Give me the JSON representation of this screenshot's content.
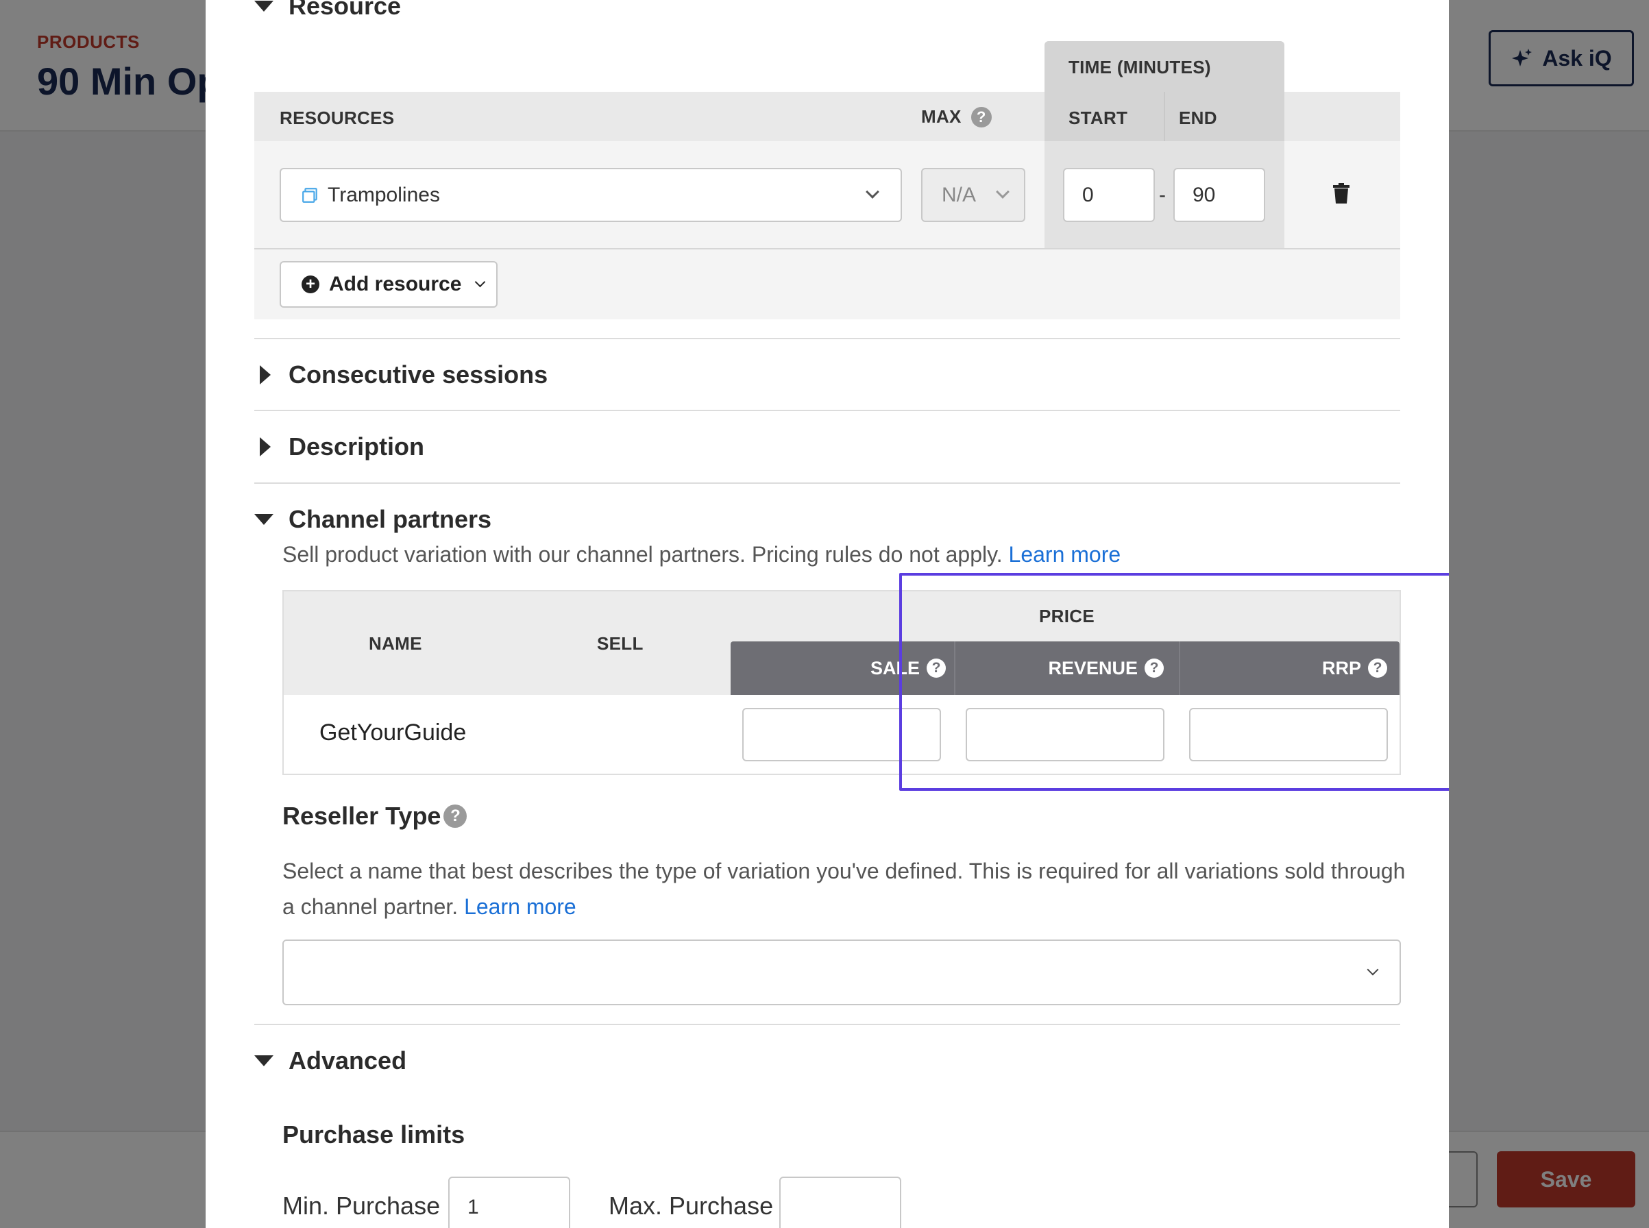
{
  "background": {
    "breadcrumb": "PRODUCTS",
    "page_title": "90 Min Op",
    "ask_iq_label": "Ask iQ",
    "save_label": "Save"
  },
  "resource": {
    "section_title": "Resource",
    "headers": {
      "resources": "RESOURCES",
      "max": "MAX",
      "time": "TIME (MINUTES)",
      "start": "START",
      "end": "END"
    },
    "row": {
      "resource_name": "Trampolines",
      "max_value": "N/A",
      "start_value": "0",
      "separator": "-",
      "end_value": "90"
    },
    "add_button": "Add resource"
  },
  "sections": {
    "consecutive": "Consecutive sessions",
    "description": "Description",
    "channel_partners": "Channel partners",
    "advanced": "Advanced"
  },
  "channel_partners": {
    "description": "Sell product variation with our channel partners. Pricing rules do not apply.",
    "learn_more": "Learn more",
    "headers": {
      "name": "NAME",
      "sell": "SELL",
      "price": "PRICE",
      "sale": "SALE",
      "revenue": "REVENUE",
      "rrp": "RRP"
    },
    "rows": [
      {
        "name": "GetYourGuide",
        "sell": true,
        "sale": "",
        "revenue": "",
        "rrp": ""
      }
    ]
  },
  "reseller": {
    "title": "Reseller Type",
    "description": "Select a name that best describes the type of variation you've defined. This is required for all variations sold through a channel partner.",
    "learn_more": "Learn more",
    "selected": ""
  },
  "advanced": {
    "purchase_limits": "Purchase limits",
    "min_label": "Min. Purchase",
    "min_value": "1",
    "max_label": "Max. Purchase",
    "max_value": ""
  },
  "colors": {
    "accent_blue": "#1a73e8",
    "link": "#1a6fd6",
    "highlight": "#5b3de0",
    "brand_red": "#c0392b",
    "navy": "#1b2a55"
  }
}
